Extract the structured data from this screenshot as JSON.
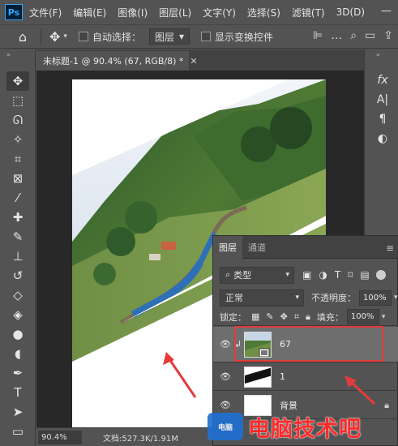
{
  "app": {
    "logo_text": "Ps",
    "menu": [
      "文件(F)",
      "编辑(E)",
      "图像(I)",
      "图层(L)",
      "文字(Y)",
      "选择(S)",
      "滤镜(T)",
      "3D(D)"
    ]
  },
  "options": {
    "auto_select_label": "自动选择：",
    "auto_select_target": "图层",
    "show_transform_label": "显示变换控件"
  },
  "document": {
    "tab_title": "未标题-1 @ 90.4% (67, RGB/8) *",
    "zoom": "90.4%",
    "doc_info": "文档:527.3K/1.91M",
    "status_arrow": ">"
  },
  "layers_panel": {
    "tabs": [
      "图层",
      "通道"
    ],
    "kind_label": "类型",
    "blend_mode": "正常",
    "opacity_label": "不透明度：",
    "opacity_value": "100%",
    "lock_label": "锁定：",
    "fill_label": "填充：",
    "fill_value": "100%",
    "layers": [
      {
        "name": "67",
        "selected": true,
        "clipped": true,
        "visible": true
      },
      {
        "name": "1",
        "selected": false,
        "clipped": false,
        "visible": true
      },
      {
        "name": "背景",
        "selected": false,
        "clipped": false,
        "visible": true,
        "locked": true
      }
    ]
  },
  "right_strip": [
    "fx-icon",
    "character-icon",
    "paragraph-icon",
    "adjust-icon"
  ],
  "annotations": {
    "highlight_color": "#e33b3b",
    "arrow_color": "#e33b3b"
  },
  "watermark": {
    "text": "电脑技术吧",
    "logo_text": "电脑"
  }
}
